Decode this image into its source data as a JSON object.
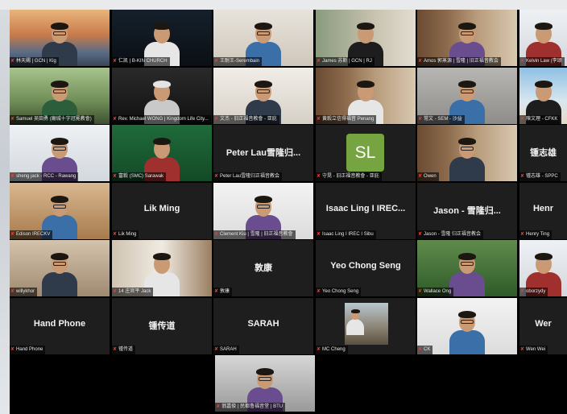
{
  "participants": [
    {
      "name": "林天賜 | GCN | Klg",
      "big": "",
      "scene": "bridge"
    },
    {
      "name": "仁凯 | B-KIN CHURCH",
      "big": "",
      "scene": "night"
    },
    {
      "name": "王耐王-Serembain",
      "big": "",
      "scene": "office"
    },
    {
      "name": "James 苏斯 | GCN | RJ",
      "big": "",
      "scene": "plant",
      "active": true
    },
    {
      "name": "Amos 郭蒸源 | 雪隆 | 旧正福音教会",
      "big": "",
      "scene": "library"
    },
    {
      "name": "Kelvin Law (李颂",
      "big": "",
      "scene": "light"
    },
    {
      "name": "Samuel 吴田勇 (廟城十字冠冕教會)",
      "big": "",
      "scene": "garden"
    },
    {
      "name": "Rev. Michael WONG | Kingdom Life City...",
      "big": "",
      "scene": "banner"
    },
    {
      "name": "文杰 - 旧正福音教會 - 亚庇",
      "big": "",
      "scene": "arch"
    },
    {
      "name": "黄毅立信得福音 Penang",
      "big": "",
      "scene": "library"
    },
    {
      "name": "常文 - SEM - 沙益",
      "big": "",
      "scene": "gray"
    },
    {
      "name": "陳文理 - CFKK",
      "big": "",
      "scene": "beach"
    },
    {
      "name": "sheng jack - RCC - Rawang",
      "big": "",
      "scene": "light"
    },
    {
      "name": "富毅 (SMC) Sarawak",
      "big": "",
      "scene": "xmas"
    },
    {
      "name": "Peter Lau雪隆归正福音教会",
      "big": "Peter Lau雪隆归...",
      "scene": "name"
    },
    {
      "name": "守晃 - 旧正福音教會 - 亚庇",
      "big": "",
      "scene": "avatar"
    },
    {
      "name": "Owen",
      "big": "",
      "scene": "library"
    },
    {
      "name": "锺志雄 - SPPC",
      "big": "锺志雄",
      "scene": "name"
    },
    {
      "name": "Edison IRECKV",
      "big": "",
      "scene": "wood"
    },
    {
      "name": "Lik Ming",
      "big": "Lik Ming",
      "scene": "name"
    },
    {
      "name": "Clement Kiu | 雪隆 | 旧正福音教會",
      "big": "",
      "scene": "white"
    },
    {
      "name": "Isaac Ling I IREC I Sibu",
      "big": "Isaac Ling I IREC...",
      "scene": "name"
    },
    {
      "name": "Jason - 雪隆 归正福音教会",
      "big": "Jason - 雪隆归...",
      "scene": "name"
    },
    {
      "name": "Henry Ting",
      "big": "Henr",
      "scene": "name"
    },
    {
      "name": "willykhor",
      "big": "",
      "scene": "room"
    },
    {
      "name": "14 庄官平 Jack",
      "big": "",
      "scene": "shelf"
    },
    {
      "name": "敦康",
      "big": "敦康",
      "scene": "name"
    },
    {
      "name": "Yeo Chong Seng",
      "big": "Yeo Chong Seng",
      "scene": "name"
    },
    {
      "name": "Wallace Ong",
      "big": "",
      "scene": "jungle"
    },
    {
      "name": "oborzydy",
      "big": "",
      "scene": "light"
    },
    {
      "name": "Hand Phone",
      "big": "Hand Phone",
      "scene": "name"
    },
    {
      "name": "锺传道",
      "big": "锺传道",
      "scene": "name"
    },
    {
      "name": "SARAH",
      "big": "SARAH",
      "scene": "name"
    },
    {
      "name": "MC Cheng",
      "big": "",
      "scene": "photo"
    },
    {
      "name": "CK",
      "big": "",
      "scene": "white"
    },
    {
      "name": "Wen Wei",
      "big": "Wer",
      "scene": "name"
    },
    {
      "name": "翁嘉俊 | 民都鲁福音堂 | BTU",
      "big": "",
      "scene": "cam"
    }
  ],
  "avatar_initials": "SL",
  "colors": {
    "active_border": "#3fb93f",
    "mic_muted": "#e0443a",
    "avatar_bg": "#76a440"
  }
}
